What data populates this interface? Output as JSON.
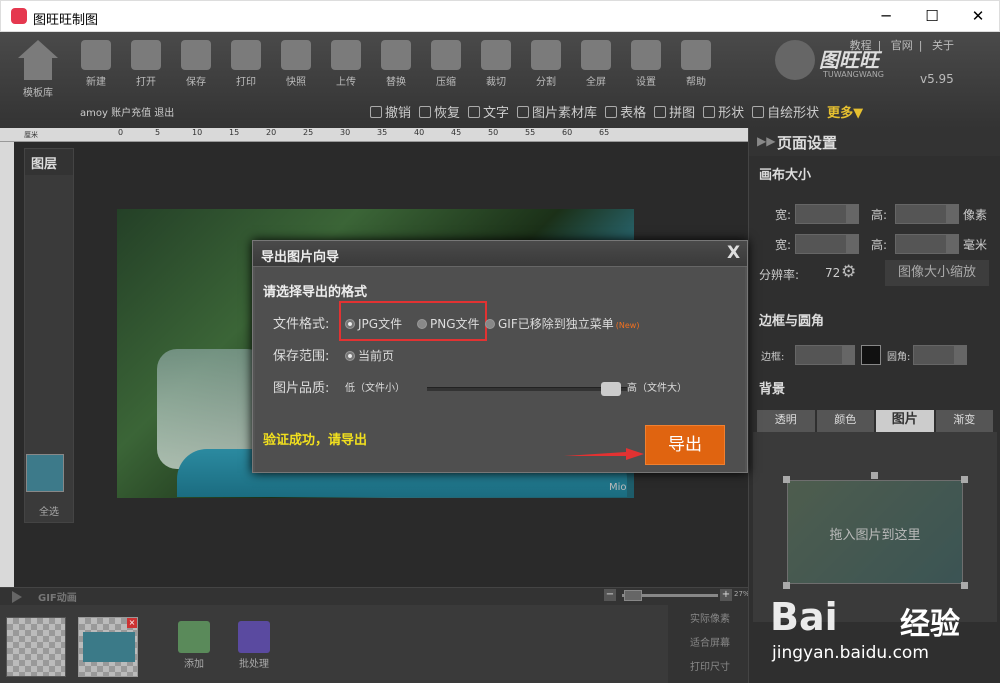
{
  "window": {
    "title": "图旺旺制图",
    "min": "─",
    "max": "☐",
    "close": "✕"
  },
  "toolbar": {
    "home": "模板库",
    "tools": [
      "新建",
      "打开",
      "保存",
      "打印",
      "快照",
      "上传",
      "替换",
      "压缩",
      "裁切",
      "分割",
      "全屏",
      "设置",
      "帮助"
    ],
    "links": [
      "教程",
      "官网",
      "关于"
    ],
    "brand_cn": "图旺旺",
    "brand_en": "TUWANGWANG",
    "version": "v5.95",
    "user": "amoy 账户充值 退出",
    "undo": "撤销",
    "redo": "恢复",
    "sub": [
      "文字",
      "图片素材库",
      "表格",
      "拼图",
      "形状",
      "自绘形状"
    ],
    "more": "更多▼"
  },
  "ruler": {
    "unit": "厘米",
    "ticks": [
      "0",
      "5",
      "10",
      "15",
      "20",
      "25",
      "30",
      "35",
      "40",
      "45",
      "50",
      "55",
      "60",
      "65"
    ]
  },
  "layers": {
    "title": "图层",
    "select_all": "全选"
  },
  "bottom": {
    "gif": "GIF动画",
    "zoom_pct": "27%",
    "add": "添加",
    "batch": "批处理",
    "view": [
      "实际像素",
      "适合屏幕",
      "打印尺寸"
    ]
  },
  "watermark": {
    "mark": "Mio"
  },
  "panel": {
    "title": "页面设置",
    "canvas_size": "画布大小",
    "width": "宽:",
    "height": "高:",
    "px": "像素",
    "mm": "毫米",
    "dpi_label": "分辨率:",
    "dpi": "72",
    "scale_btn": "图像大小缩放",
    "border_sect": "边框与圆角",
    "border": "边框:",
    "corner": "圆角:",
    "bg_sect": "背景",
    "bg_tabs": [
      "透明",
      "颜色",
      "图片",
      "渐变"
    ],
    "bg_caption": "拖入图片到这里"
  },
  "baidu": {
    "logo": "Bai",
    "jingyan": "经验",
    "url": "jingyan.baidu.com"
  },
  "dialog": {
    "title": "导出图片向导",
    "close": "X",
    "question": "请选择导出的格式",
    "format_label": "文件格式:",
    "jpg": "JPG文件",
    "png": "PNG文件",
    "gif": "GIF已移除到独立菜单",
    "new": "(New)",
    "range_label": "保存范围:",
    "range_value": "当前页",
    "quality_label": "图片品质:",
    "quality_low": "低（文件小）",
    "quality_high": "高（文件大）",
    "success": "验证成功，请导出",
    "export": "导出"
  }
}
